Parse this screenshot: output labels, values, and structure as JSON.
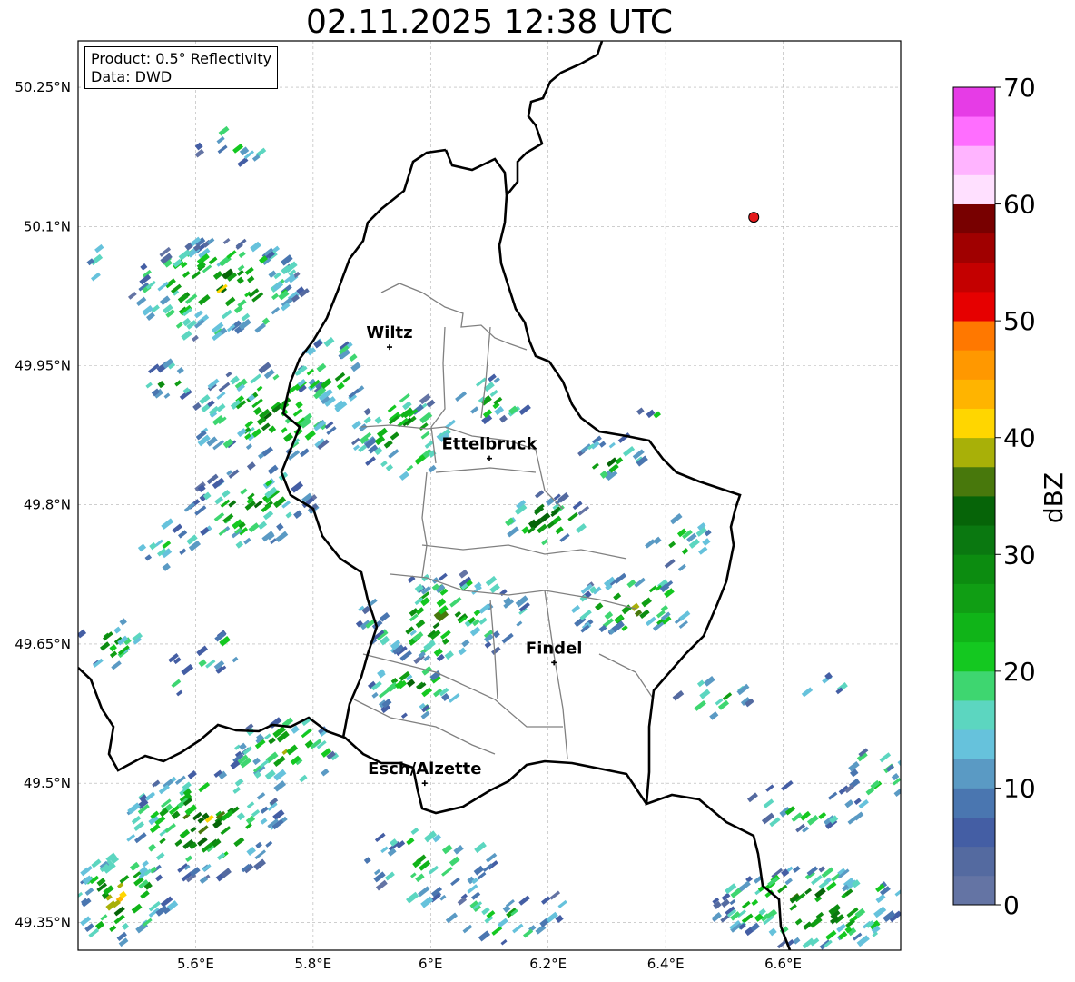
{
  "title": "02.11.2025 12:38 UTC",
  "info": {
    "product": "Product: 0.5° Reflectivity",
    "data": "Data: DWD"
  },
  "lat_ticks": [
    "50.25°N",
    "50.1°N",
    "49.95°N",
    "49.8°N",
    "49.65°N",
    "49.5°N",
    "49.35°N"
  ],
  "lon_ticks": [
    "5.6°E",
    "5.8°E",
    "6°E",
    "6.2°E",
    "6.4°E",
    "6.6°E"
  ],
  "cities": [
    {
      "name": "Wiltz",
      "lon": 5.93,
      "lat": 49.97
    },
    {
      "name": "Ettelbruck",
      "lon": 6.1,
      "lat": 49.85
    },
    {
      "name": "Findel",
      "lon": 6.21,
      "lat": 49.63
    },
    {
      "name": "Esch/Alzette",
      "lon": 5.99,
      "lat": 49.5
    }
  ],
  "radar_site": {
    "lon": 6.55,
    "lat": 50.11,
    "color": "#e41a1c"
  },
  "colorbar": {
    "label": "dBZ",
    "ticks": [
      "0",
      "10",
      "20",
      "30",
      "40",
      "50",
      "60",
      "70"
    ],
    "colors": [
      "#6474a4",
      "#546aa0",
      "#445ea4",
      "#4a76b0",
      "#5a9ac4",
      "#66c2dc",
      "#5cd6c0",
      "#3ed670",
      "#14c820",
      "#10b418",
      "#109e14",
      "#0c8c10",
      "#0a7810",
      "#066408",
      "#48780c",
      "#a8b008",
      "#ffd600",
      "#ffb400",
      "#ff9800",
      "#ff7800",
      "#e60000",
      "#c40000",
      "#a00000",
      "#780000",
      "#ffe0ff",
      "#ffb4ff",
      "#ff6eff",
      "#e63ce6"
    ]
  }
}
